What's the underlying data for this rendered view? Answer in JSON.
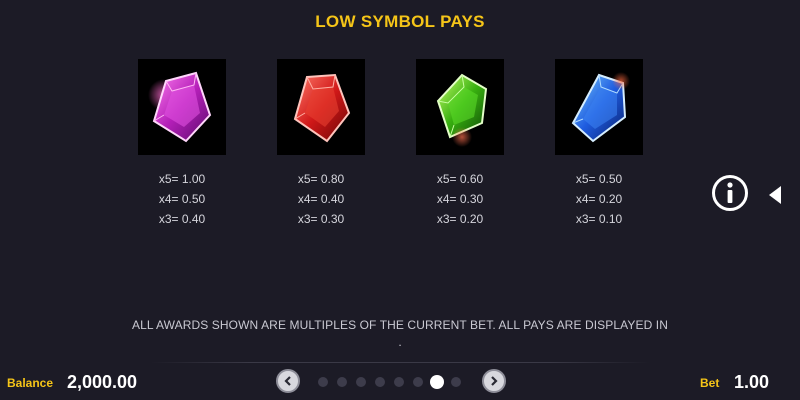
{
  "title": "LOW SYMBOL PAYS",
  "symbols": [
    {
      "icon": "pink-gem-icon",
      "color": "#d23cc8",
      "pays": [
        "x5= 1.00",
        "x4= 0.50",
        "x3= 0.40"
      ]
    },
    {
      "icon": "red-gem-icon",
      "color": "#e02a2a",
      "pays": [
        "x5= 0.80",
        "x4= 0.40",
        "x3= 0.30"
      ]
    },
    {
      "icon": "green-gem-icon",
      "color": "#48c818",
      "pays": [
        "x5= 0.60",
        "x4= 0.30",
        "x3= 0.20"
      ]
    },
    {
      "icon": "blue-gem-icon",
      "color": "#1f63e8",
      "pays": [
        "x5= 0.50",
        "x4= 0.20",
        "x3= 0.10"
      ]
    }
  ],
  "note": "ALL AWARDS SHOWN ARE MULTIPLES OF THE CURRENT BET. ALL PAYS ARE DISPLAYED IN",
  "note_dot": ".",
  "footer": {
    "balance_label": "Balance",
    "balance_value": "2,000.00",
    "bet_label": "Bet",
    "bet_value": "1.00"
  },
  "pager": {
    "total": 8,
    "active": 6
  },
  "colors": {
    "accent": "#f5c518",
    "background": "#1c1b26"
  }
}
